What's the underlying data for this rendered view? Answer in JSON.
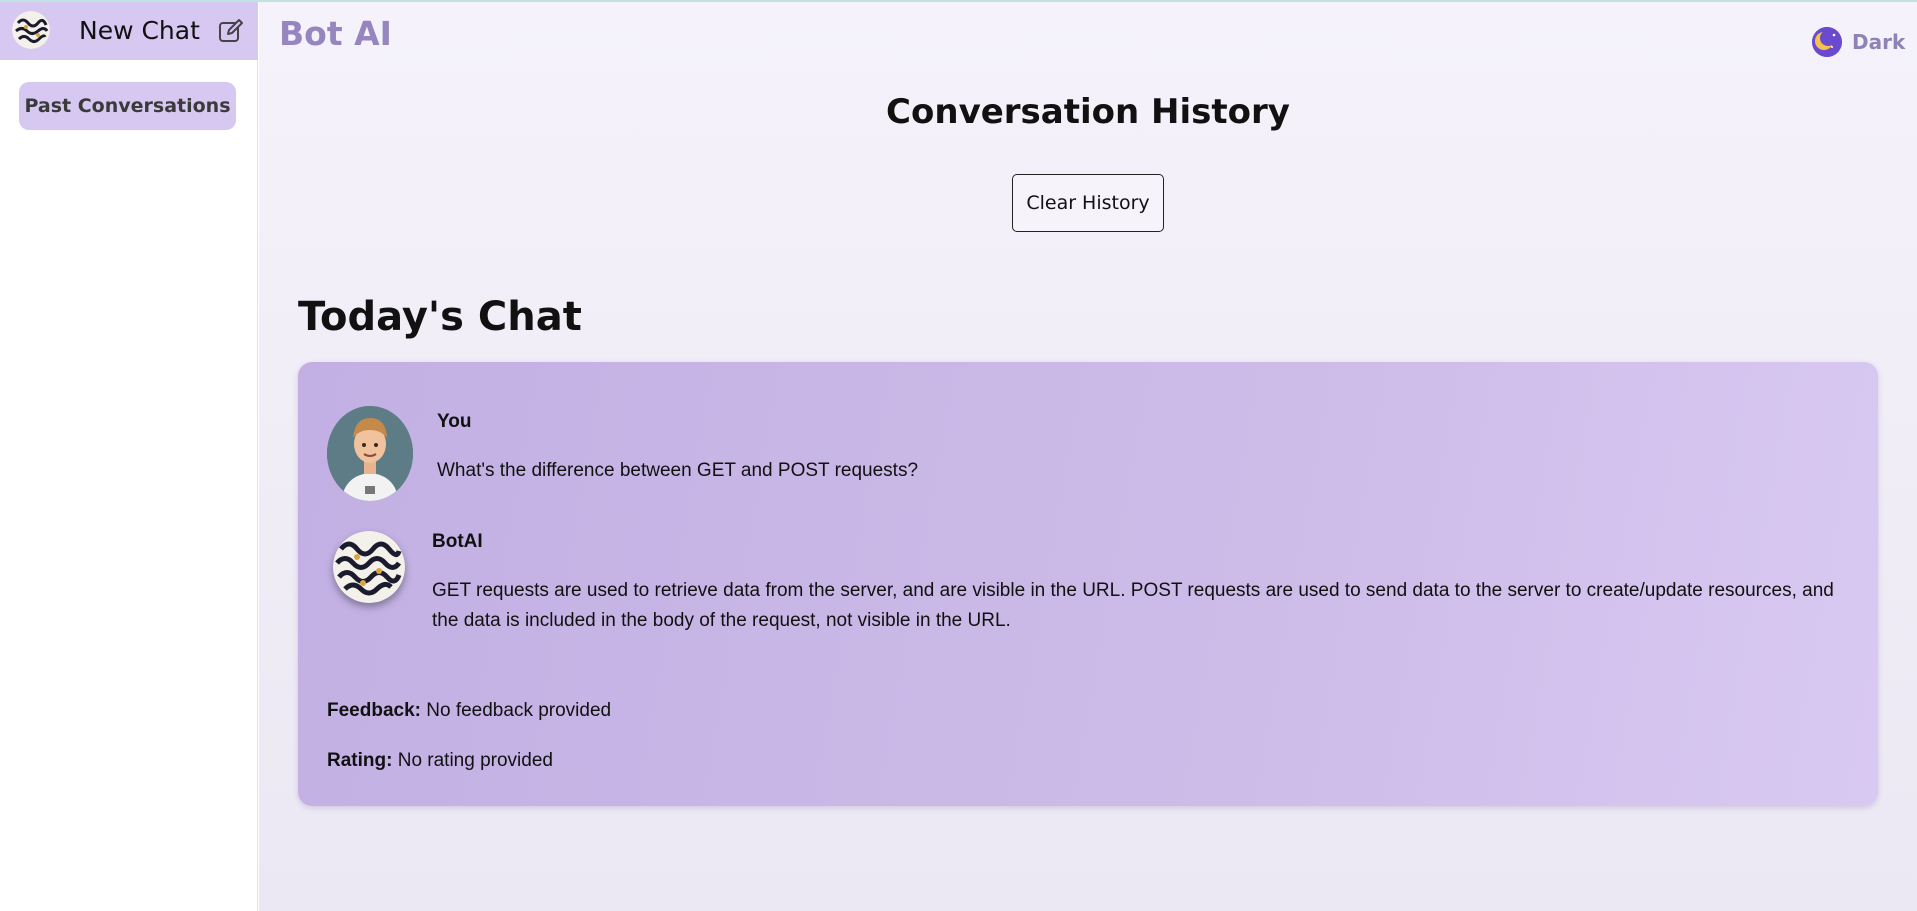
{
  "sidebar": {
    "new_chat_label": "New Chat",
    "past_conversations_label": "Past Conversations"
  },
  "header": {
    "brand": "Bot AI",
    "theme_label": "Dark"
  },
  "main": {
    "title": "Conversation History",
    "clear_button": "Clear History",
    "section_title": "Today's Chat",
    "conversation": {
      "user_name": "You",
      "user_message": "What's the difference between GET and POST requests?",
      "bot_name": "BotAI",
      "bot_message": "GET requests are used to retrieve data from the server, and are visible in the URL. POST requests are used to send data to the server to create/update resources, and the data is included in the body of the request, not visible in the URL.",
      "feedback_label": "Feedback:",
      "feedback_value": "No feedback provided",
      "rating_label": "Rating:",
      "rating_value": "No rating provided"
    }
  },
  "colors": {
    "accent": "#d7c8f2",
    "brand": "#9785c0",
    "card": "#c8b6e6"
  },
  "icons": {
    "logo": "bot-logo-icon",
    "edit": "edit-icon",
    "moon": "moon-icon"
  }
}
